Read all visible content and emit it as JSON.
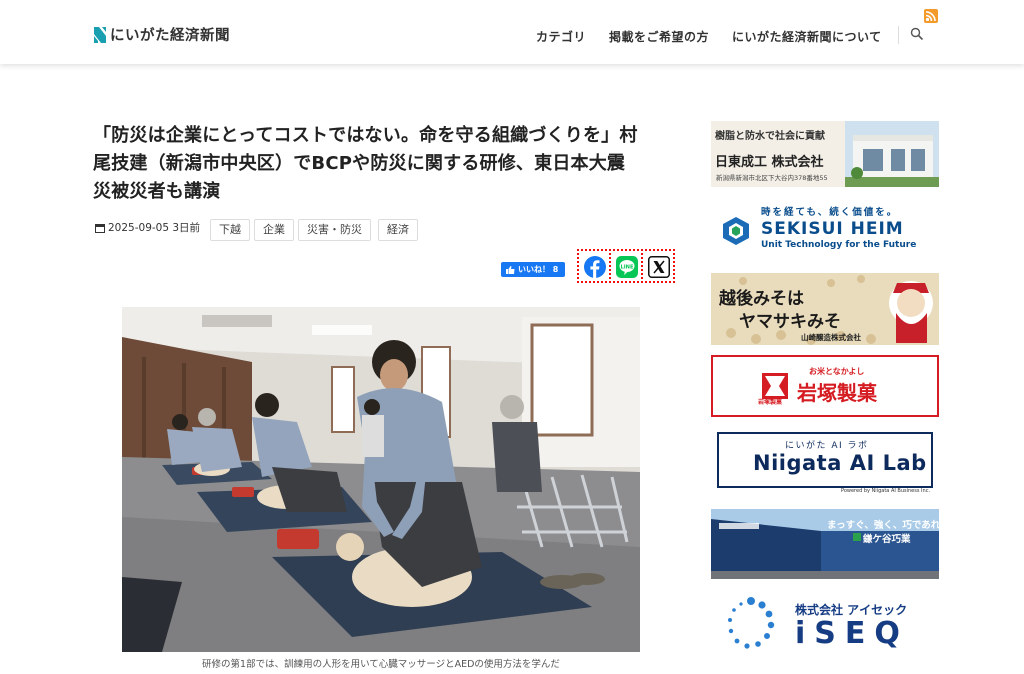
{
  "site": {
    "logo_text": "にいがた経済新聞"
  },
  "nav": {
    "items": [
      "カテゴリ",
      "掲載をご希望の方",
      "にいがた経済新聞について"
    ]
  },
  "article": {
    "title_lines": [
      "「防災は企業にとってコストではない。命を守る組織づくりを」村",
      "尾技建（新潟市中央区）でBCPや防災に関する研修、東日本大震",
      "災被災者も講演"
    ],
    "date": "2025-09-05 3日前",
    "tags": [
      "下越",
      "企業",
      "災害・防災",
      "経済"
    ],
    "like_label": "いいね！ 8",
    "caption": "研修の第1部では、訓練用の人形を用いて心臓マッサージとAEDの使用方法を学んだ"
  },
  "sidebar": {
    "b1": {
      "headline": "樹脂と防水で社会に貢献",
      "name": "日東成工 株式会社",
      "address": "新潟県新潟市北区下大谷内378番地55"
    },
    "b2": {
      "tagline": "時を経ても、続く価値を。",
      "name": "SEKISUI HEIM",
      "sub": "Unit Technology for the Future"
    },
    "b3": {
      "line1": "越後みそは",
      "line2": "ヤマサキみそ",
      "company": "山崎醸造株式会社"
    },
    "b4": {
      "small": "お米となかよし",
      "name": "岩塚製菓",
      "mark": "岩塚製菓"
    },
    "b5": {
      "small": "にいがた AI ラボ",
      "name": "Niigata AI Lab",
      "foot": "Powered by Niigata AI Business Inc."
    },
    "b6": {
      "line1": "まっすぐ、強く、巧であれ。",
      "name": "鎌ケ谷巧業"
    },
    "b7": {
      "small": "株式会社 アイセック",
      "name": "iSEQ"
    }
  },
  "colors": {
    "brand_teal": "#1a9fb0",
    "fb": "#1877f2",
    "line": "#06c755",
    "rss": "#f39a2b",
    "iwatsuka_red": "#d51c22"
  }
}
